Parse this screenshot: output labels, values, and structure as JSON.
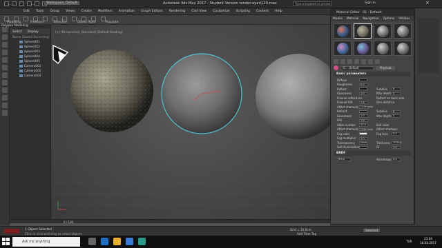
{
  "window": {
    "workspace": "Workspace: Default",
    "title": "Autodesk 3ds Max 2017 - Student Version   render-ayari123.max",
    "search_placeholder": "Type a keyword or phrase",
    "signin": "Sign In"
  },
  "menu": [
    "Edit",
    "Tools",
    "Group",
    "Views",
    "Create",
    "Modifiers",
    "Animation",
    "Graph Editors",
    "Rendering",
    "Civil View",
    "Customize",
    "Scripting",
    "Content",
    "Help"
  ],
  "ribbon_tabs": [
    "Modeling",
    "Freeform",
    "Selection",
    "Object Paint",
    "Populate"
  ],
  "ribbon_sub": "Polygon Modeling",
  "viewport_label": "[+] [Perspective] [Standard] [Default Shading]",
  "scene_explorer": {
    "tabs": [
      "Select",
      "Display"
    ],
    "header": "Name (Sorted Ascending)",
    "items": [
      "Sphere001",
      "Sphere002",
      "Sphere003",
      "Sphere004",
      "Sphere005",
      "Camera001",
      "Camera002",
      "Camera003"
    ]
  },
  "material_editor": {
    "title": "Material Editor - 01 - Default",
    "menus": [
      "Modes",
      "Material",
      "Navigation",
      "Options",
      "Utilities"
    ],
    "material_name": "01 - Default",
    "material_type": "Physical",
    "basic_parameters": "Basic parameters",
    "params": [
      {
        "label": "Diffuse",
        "value": "",
        "swatch": "dark",
        "r_label": "",
        "r_value": ""
      },
      {
        "label": "Roughness",
        "value": "0.0",
        "swatch": "none",
        "r_label": "",
        "r_value": ""
      },
      {
        "label": "Reflect",
        "value": "",
        "swatch": "dark",
        "r_label": "Subdivs",
        "r_value": "8"
      },
      {
        "label": "Glossiness",
        "value": "1.0",
        "swatch": "none",
        "r_label": "Max depth",
        "r_value": "5"
      },
      {
        "label": "Fresnel reflections",
        "value": "",
        "swatch": "none",
        "r_label": "Reflect on back side",
        "r_value": ""
      },
      {
        "label": "Fresnel IOR",
        "value": "1.6",
        "swatch": "none",
        "r_label": "Dim distance",
        "r_value": ""
      },
      {
        "label": "Affect channels",
        "value": "Color only",
        "swatch": "none",
        "r_label": "",
        "r_value": ""
      },
      {
        "label": "Refract",
        "value": "",
        "swatch": "dark",
        "r_label": "Subdivs",
        "r_value": "8"
      },
      {
        "label": "Glossiness",
        "value": "1.0",
        "swatch": "none",
        "r_label": "Max depth",
        "r_value": "5"
      },
      {
        "label": "IOR",
        "value": "1.6",
        "swatch": "none",
        "r_label": "",
        "r_value": ""
      },
      {
        "label": "Abbe number",
        "value": "50.0",
        "swatch": "none",
        "r_label": "Exit color",
        "r_value": ""
      },
      {
        "label": "Affect channels",
        "value": "Color only",
        "swatch": "none",
        "r_label": "Affect shadows",
        "r_value": ""
      },
      {
        "label": "Fog color",
        "value": "",
        "swatch": "light",
        "r_label": "Fog bias",
        "r_value": "0.0"
      },
      {
        "label": "Fog multiplier",
        "value": "1.0",
        "swatch": "none",
        "r_label": "",
        "r_value": ""
      },
      {
        "label": "Translucency",
        "value": "None",
        "swatch": "none",
        "r_label": "Thickness",
        "r_value": "1000.0"
      },
      {
        "label": "Self-illumination",
        "value": "",
        "swatch": "dark",
        "r_label": "GI",
        "r_value": "1.0"
      }
    ],
    "brdf": "BRDF",
    "brdf_type": "Blinn",
    "anisotropy": "Anisotropy",
    "anisotropy_value": "0.0"
  },
  "status": {
    "selected": "1 Object Selected",
    "prompt": "Click or click-and-drag to select objects",
    "frame": "0 / 100",
    "add_time_tag": "Add Time Tag",
    "selected_mode": "Selected",
    "grid": "Grid = 10.0cm"
  },
  "taskbar": {
    "search_placeholder": "Ask me anything",
    "time": "23:04",
    "date": "18.04.2017",
    "lang": "TUR"
  }
}
